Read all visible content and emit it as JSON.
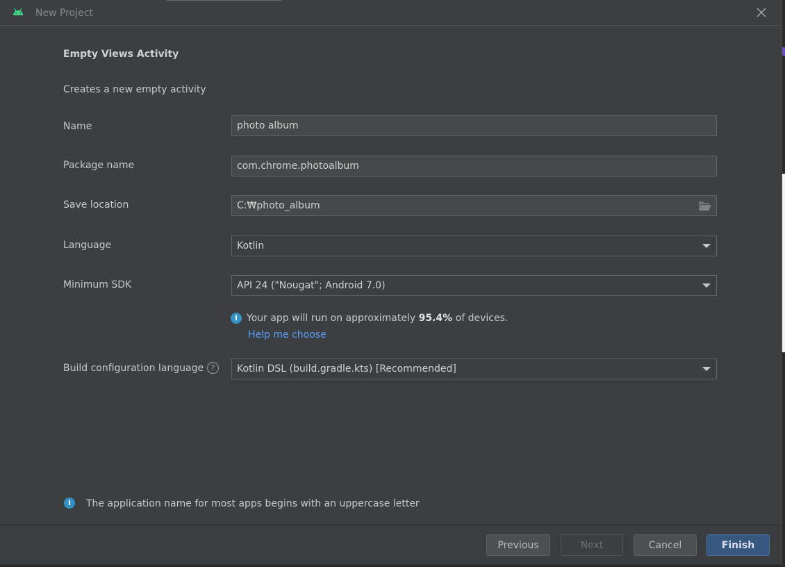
{
  "window": {
    "title": "New Project"
  },
  "page": {
    "heading": "Empty Views Activity",
    "description": "Creates a new empty activity"
  },
  "form": {
    "name": {
      "label": "Name",
      "value": "photo album"
    },
    "package": {
      "label": "Package name",
      "value": "com.chrome.photoalbum"
    },
    "location": {
      "label": "Save location",
      "value": "C:₩photo_album"
    },
    "language": {
      "label": "Language",
      "value": "Kotlin"
    },
    "min_sdk": {
      "label": "Minimum SDK",
      "value": "API 24 (\"Nougat\"; Android 7.0)"
    },
    "coverage": {
      "prefix": "Your app will run on approximately",
      "percent": "95.4%",
      "suffix": "of devices.",
      "link": "Help me choose"
    },
    "build_lang": {
      "label": "Build configuration language",
      "value": "Kotlin DSL (build.gradle.kts) [Recommended]"
    }
  },
  "hint": "The application name for most apps begins with an uppercase letter",
  "buttons": {
    "previous": "Previous",
    "next": "Next",
    "cancel": "Cancel",
    "finish": "Finish"
  },
  "colors": {
    "accent": "#365880",
    "link": "#589df6",
    "info": "#3592c4",
    "android": "#3ddc84"
  }
}
